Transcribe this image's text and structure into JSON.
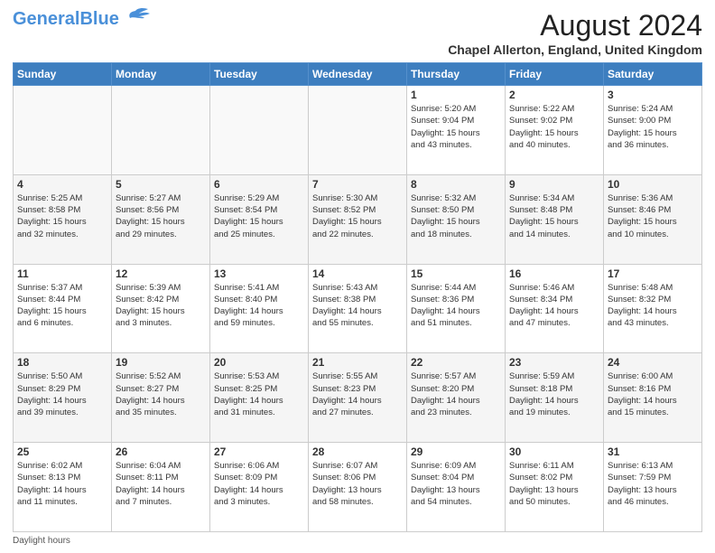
{
  "header": {
    "logo_line1": "General",
    "logo_line2": "Blue",
    "month_title": "August 2024",
    "location": "Chapel Allerton, England, United Kingdom"
  },
  "days_of_week": [
    "Sunday",
    "Monday",
    "Tuesday",
    "Wednesday",
    "Thursday",
    "Friday",
    "Saturday"
  ],
  "weeks": [
    [
      {
        "day": "",
        "info": ""
      },
      {
        "day": "",
        "info": ""
      },
      {
        "day": "",
        "info": ""
      },
      {
        "day": "",
        "info": ""
      },
      {
        "day": "1",
        "info": "Sunrise: 5:20 AM\nSunset: 9:04 PM\nDaylight: 15 hours\nand 43 minutes."
      },
      {
        "day": "2",
        "info": "Sunrise: 5:22 AM\nSunset: 9:02 PM\nDaylight: 15 hours\nand 40 minutes."
      },
      {
        "day": "3",
        "info": "Sunrise: 5:24 AM\nSunset: 9:00 PM\nDaylight: 15 hours\nand 36 minutes."
      }
    ],
    [
      {
        "day": "4",
        "info": "Sunrise: 5:25 AM\nSunset: 8:58 PM\nDaylight: 15 hours\nand 32 minutes."
      },
      {
        "day": "5",
        "info": "Sunrise: 5:27 AM\nSunset: 8:56 PM\nDaylight: 15 hours\nand 29 minutes."
      },
      {
        "day": "6",
        "info": "Sunrise: 5:29 AM\nSunset: 8:54 PM\nDaylight: 15 hours\nand 25 minutes."
      },
      {
        "day": "7",
        "info": "Sunrise: 5:30 AM\nSunset: 8:52 PM\nDaylight: 15 hours\nand 22 minutes."
      },
      {
        "day": "8",
        "info": "Sunrise: 5:32 AM\nSunset: 8:50 PM\nDaylight: 15 hours\nand 18 minutes."
      },
      {
        "day": "9",
        "info": "Sunrise: 5:34 AM\nSunset: 8:48 PM\nDaylight: 15 hours\nand 14 minutes."
      },
      {
        "day": "10",
        "info": "Sunrise: 5:36 AM\nSunset: 8:46 PM\nDaylight: 15 hours\nand 10 minutes."
      }
    ],
    [
      {
        "day": "11",
        "info": "Sunrise: 5:37 AM\nSunset: 8:44 PM\nDaylight: 15 hours\nand 6 minutes."
      },
      {
        "day": "12",
        "info": "Sunrise: 5:39 AM\nSunset: 8:42 PM\nDaylight: 15 hours\nand 3 minutes."
      },
      {
        "day": "13",
        "info": "Sunrise: 5:41 AM\nSunset: 8:40 PM\nDaylight: 14 hours\nand 59 minutes."
      },
      {
        "day": "14",
        "info": "Sunrise: 5:43 AM\nSunset: 8:38 PM\nDaylight: 14 hours\nand 55 minutes."
      },
      {
        "day": "15",
        "info": "Sunrise: 5:44 AM\nSunset: 8:36 PM\nDaylight: 14 hours\nand 51 minutes."
      },
      {
        "day": "16",
        "info": "Sunrise: 5:46 AM\nSunset: 8:34 PM\nDaylight: 14 hours\nand 47 minutes."
      },
      {
        "day": "17",
        "info": "Sunrise: 5:48 AM\nSunset: 8:32 PM\nDaylight: 14 hours\nand 43 minutes."
      }
    ],
    [
      {
        "day": "18",
        "info": "Sunrise: 5:50 AM\nSunset: 8:29 PM\nDaylight: 14 hours\nand 39 minutes."
      },
      {
        "day": "19",
        "info": "Sunrise: 5:52 AM\nSunset: 8:27 PM\nDaylight: 14 hours\nand 35 minutes."
      },
      {
        "day": "20",
        "info": "Sunrise: 5:53 AM\nSunset: 8:25 PM\nDaylight: 14 hours\nand 31 minutes."
      },
      {
        "day": "21",
        "info": "Sunrise: 5:55 AM\nSunset: 8:23 PM\nDaylight: 14 hours\nand 27 minutes."
      },
      {
        "day": "22",
        "info": "Sunrise: 5:57 AM\nSunset: 8:20 PM\nDaylight: 14 hours\nand 23 minutes."
      },
      {
        "day": "23",
        "info": "Sunrise: 5:59 AM\nSunset: 8:18 PM\nDaylight: 14 hours\nand 19 minutes."
      },
      {
        "day": "24",
        "info": "Sunrise: 6:00 AM\nSunset: 8:16 PM\nDaylight: 14 hours\nand 15 minutes."
      }
    ],
    [
      {
        "day": "25",
        "info": "Sunrise: 6:02 AM\nSunset: 8:13 PM\nDaylight: 14 hours\nand 11 minutes."
      },
      {
        "day": "26",
        "info": "Sunrise: 6:04 AM\nSunset: 8:11 PM\nDaylight: 14 hours\nand 7 minutes."
      },
      {
        "day": "27",
        "info": "Sunrise: 6:06 AM\nSunset: 8:09 PM\nDaylight: 14 hours\nand 3 minutes."
      },
      {
        "day": "28",
        "info": "Sunrise: 6:07 AM\nSunset: 8:06 PM\nDaylight: 13 hours\nand 58 minutes."
      },
      {
        "day": "29",
        "info": "Sunrise: 6:09 AM\nSunset: 8:04 PM\nDaylight: 13 hours\nand 54 minutes."
      },
      {
        "day": "30",
        "info": "Sunrise: 6:11 AM\nSunset: 8:02 PM\nDaylight: 13 hours\nand 50 minutes."
      },
      {
        "day": "31",
        "info": "Sunrise: 6:13 AM\nSunset: 7:59 PM\nDaylight: 13 hours\nand 46 minutes."
      }
    ]
  ],
  "footer": {
    "daylight_label": "Daylight hours"
  }
}
